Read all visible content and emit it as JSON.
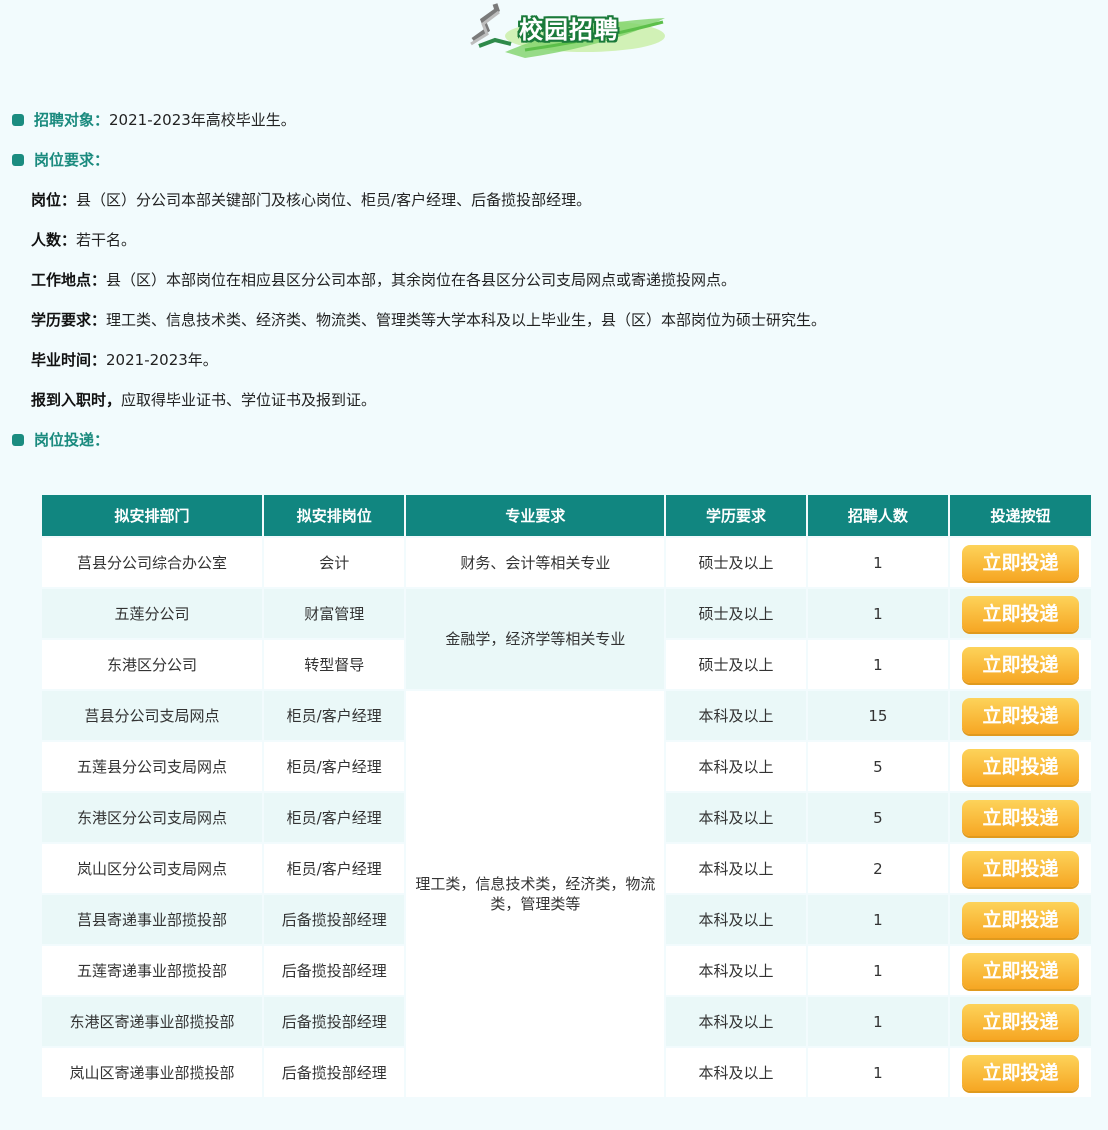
{
  "banner": {
    "title": "校园招聘"
  },
  "sections": {
    "target": {
      "label": "招聘对象：",
      "value": "2021-2023年高校毕业生。"
    },
    "requirements": {
      "label": "岗位要求："
    },
    "apply": {
      "label": "岗位投递："
    }
  },
  "requirements": [
    {
      "label": "岗位：",
      "text": "县（区）分公司本部关键部门及核心岗位、柜员/客户经理、后备揽投部经理。"
    },
    {
      "label": "人数：",
      "text": "若干名。"
    },
    {
      "label": "工作地点：",
      "text": "县（区）本部岗位在相应县区分公司本部，其余岗位在各县区分公司支局网点或寄递揽投网点。"
    },
    {
      "label": "学历要求：",
      "text": "理工类、信息技术类、经济类、物流类、管理类等大学本科及以上毕业生，县（区）本部岗位为硕士研究生。"
    },
    {
      "label": "毕业时间：",
      "text": "2021-2023年。"
    },
    {
      "label": "报到入职时，",
      "text": "应取得毕业证书、学位证书及报到证。"
    }
  ],
  "table": {
    "headers": [
      "拟安排部门",
      "拟安排岗位",
      "专业要求",
      "学历要求",
      "招聘人数",
      "投递按钮"
    ],
    "major_groups": [
      "财务、会计等相关专业",
      "金融学，经济学等相关专业",
      "理工类，信息技术类，经济类，物流类，管理类等"
    ],
    "rows": [
      {
        "dept": "莒县分公司综合办公室",
        "post": "会计",
        "edu": "硕士及以上",
        "count": "1",
        "button": "立即投递"
      },
      {
        "dept": "五莲分公司",
        "post": "财富管理",
        "edu": "硕士及以上",
        "count": "1",
        "button": "立即投递"
      },
      {
        "dept": "东港区分公司",
        "post": "转型督导",
        "edu": "硕士及以上",
        "count": "1",
        "button": "立即投递"
      },
      {
        "dept": "莒县分公司支局网点",
        "post": "柜员/客户经理",
        "edu": "本科及以上",
        "count": "15",
        "button": "立即投递"
      },
      {
        "dept": "五莲县分公司支局网点",
        "post": "柜员/客户经理",
        "edu": "本科及以上",
        "count": "5",
        "button": "立即投递"
      },
      {
        "dept": "东港区分公司支局网点",
        "post": "柜员/客户经理",
        "edu": "本科及以上",
        "count": "5",
        "button": "立即投递"
      },
      {
        "dept": "岚山区分公司支局网点",
        "post": "柜员/客户经理",
        "edu": "本科及以上",
        "count": "2",
        "button": "立即投递"
      },
      {
        "dept": "莒县寄递事业部揽投部",
        "post": "后备揽投部经理",
        "edu": "本科及以上",
        "count": "1",
        "button": "立即投递"
      },
      {
        "dept": "五莲寄递事业部揽投部",
        "post": "后备揽投部经理",
        "edu": "本科及以上",
        "count": "1",
        "button": "立即投递"
      },
      {
        "dept": "东港区寄递事业部揽投部",
        "post": "后备揽投部经理",
        "edu": "本科及以上",
        "count": "1",
        "button": "立即投递"
      },
      {
        "dept": "岚山区寄递事业部揽投部",
        "post": "后备揽投部经理",
        "edu": "本科及以上",
        "count": "1",
        "button": "立即投递"
      }
    ]
  }
}
